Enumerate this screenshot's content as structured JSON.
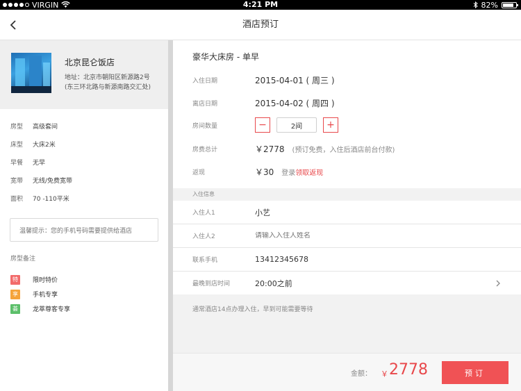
{
  "status_bar": {
    "carrier": "VIRGIN",
    "time": "4:21 PM",
    "battery": "82%",
    "battery_level": 0.82
  },
  "nav": {
    "title": "酒店预订"
  },
  "hotel": {
    "name": "北京昆仑饭店",
    "address_line1": "地址：北京市朝阳区新源路2号",
    "address_line2": "(东三环北路与新源南路交汇处)"
  },
  "room_info": [
    {
      "key": "房型",
      "value": "高级套间"
    },
    {
      "key": "床型",
      "value": "大床2米"
    },
    {
      "key": "早餐",
      "value": "无早"
    },
    {
      "key": "宽带",
      "value": "无线/免费宽带"
    },
    {
      "key": "面积",
      "value": "70 -110平米"
    }
  ],
  "tip": "温馨提示：您的手机号码需要提供给酒店",
  "remarks": {
    "title": "房型备注",
    "items": [
      {
        "badge": "特",
        "label": "限时特价",
        "color": "#f26b6b"
      },
      {
        "badge": "享",
        "label": "手机专享",
        "color": "#f5a33a"
      },
      {
        "badge": "荟",
        "label": "龙萃尊客专享",
        "color": "#5cbf6a"
      }
    ]
  },
  "booking": {
    "room_title": "豪华大床房 - 单早",
    "checkin": {
      "label": "入住日期",
      "value": "2015-04-01 ( 周三 )"
    },
    "checkout": {
      "label": "离店日期",
      "value": "2015-04-02 ( 周四 )"
    },
    "rooms": {
      "label": "房间数量",
      "minus": "−",
      "value": "2间",
      "plus": "+"
    },
    "total": {
      "label": "房费总计",
      "value": "￥2778",
      "note": "(预订免费，入住后酒店前台付款)"
    },
    "cashback": {
      "label": "返现",
      "value": "￥30",
      "note_prefix": "登录",
      "note_link": "领取返现"
    }
  },
  "guest_section": {
    "header": "入住信息",
    "guest1": {
      "label": "入住人1",
      "value": "小艺"
    },
    "guest2": {
      "label": "入住人2",
      "placeholder": "请输入入住人姓名"
    },
    "phone": {
      "label": "联系手机",
      "value": "13412345678"
    },
    "arrival": {
      "label": "最晚到店时间",
      "value": "20:00之前"
    }
  },
  "footer_note": "通常酒店14点办理入住，早到可能需要等待",
  "bottom": {
    "amount_label": "金额：",
    "currency": "￥",
    "amount": "2778",
    "book_label": "预订"
  },
  "colors": {
    "accent": "#e8484b",
    "button": "#f05255"
  }
}
